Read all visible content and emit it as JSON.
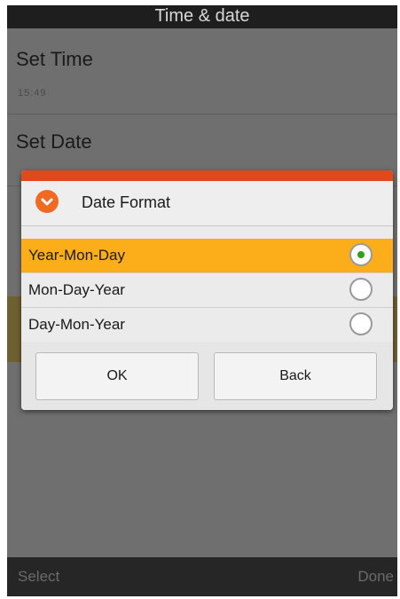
{
  "app": {
    "title": "Time & date"
  },
  "settings": [
    {
      "title": "Set Time",
      "value": "15:49"
    },
    {
      "title": "Set Date",
      "value": ""
    }
  ],
  "dialog": {
    "title": "Date Format",
    "icon": "chevron-down-icon",
    "accent_color": "#e0491c",
    "options": [
      {
        "label": "Year-Mon-Day",
        "selected": true
      },
      {
        "label": "Mon-Day-Year",
        "selected": false
      },
      {
        "label": "Day-Mon-Year",
        "selected": false
      }
    ],
    "buttons": {
      "ok": "OK",
      "back": "Back"
    },
    "selected_color": "#fcae1a"
  },
  "softkeys": {
    "left": "Select",
    "right": "Done"
  }
}
